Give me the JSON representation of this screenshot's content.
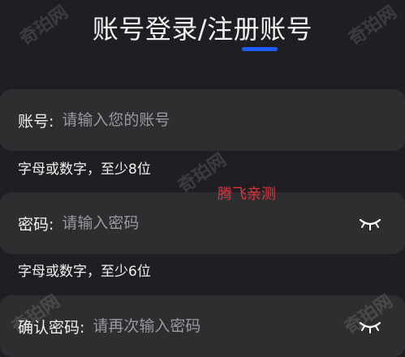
{
  "page": {
    "title": "账号登录/注册账号"
  },
  "account": {
    "label": "账号:",
    "placeholder": "请输入您的账号",
    "hint": "字母或数字，至少8位"
  },
  "password": {
    "label": "密码:",
    "placeholder": "请输入密码",
    "hint": "字母或数字，至少6位",
    "toggle_icon": "eye-closed-icon"
  },
  "confirm_password": {
    "label": "确认密码:",
    "placeholder": "请再次输入密码",
    "toggle_icon": "eye-closed-icon"
  },
  "overlay": {
    "red_text": "腾飞亲测",
    "watermark": "奇珀网"
  },
  "colors": {
    "background": "#1f1f23",
    "field_background": "#2e2e31",
    "accent": "#1e5cff",
    "placeholder": "#9a9a9e",
    "overlay_red": "#e0333a"
  }
}
